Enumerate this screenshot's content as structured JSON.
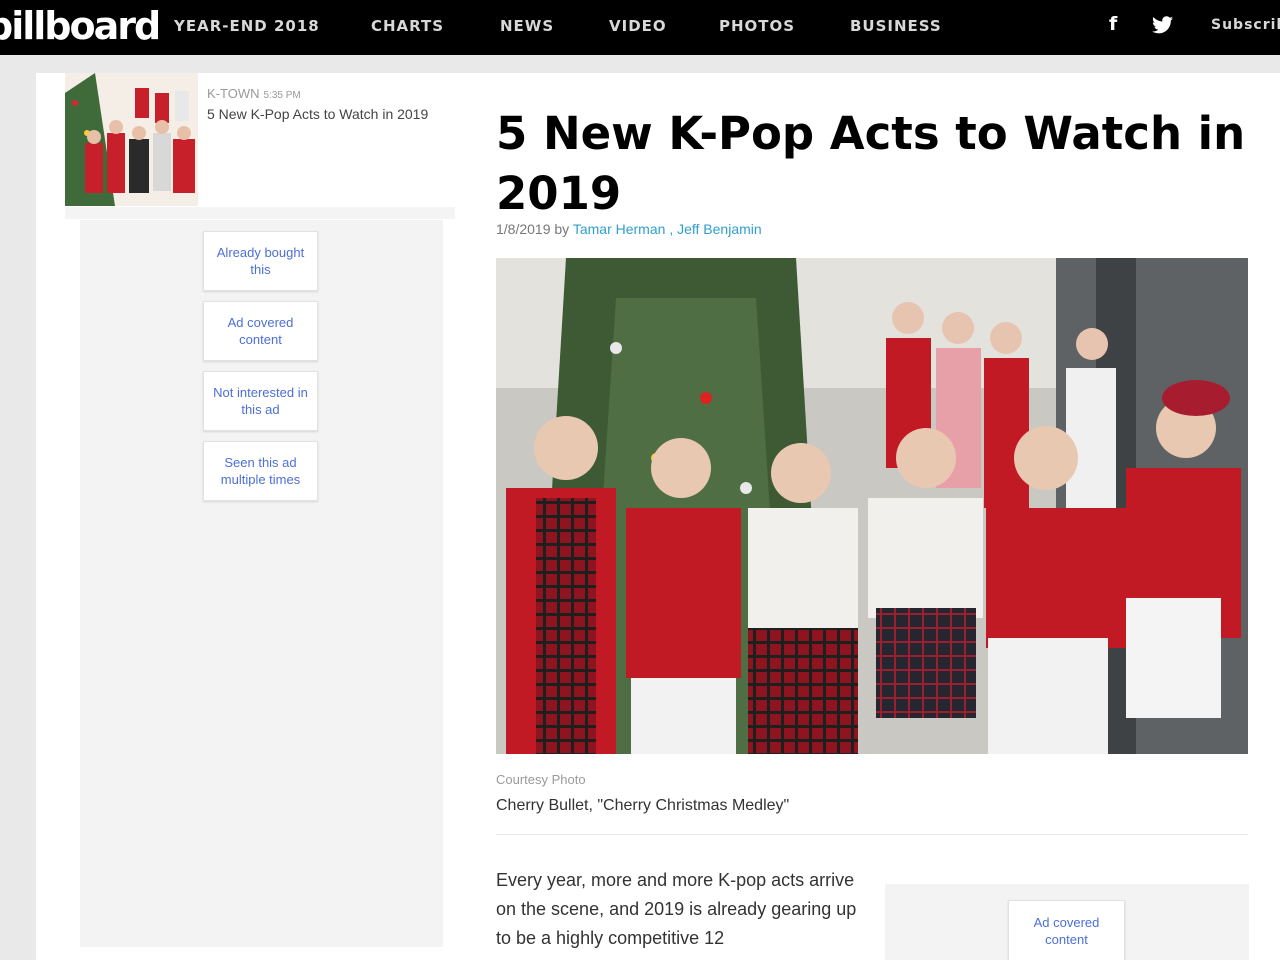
{
  "header": {
    "logo": "billboard",
    "nav": [
      "YEAR-END 2018",
      "CHARTS",
      "NEWS",
      "VIDEO",
      "PHOTOS",
      "BUSINESS"
    ],
    "social": {
      "facebook": "f"
    },
    "subscribe": "Subscribe"
  },
  "sidebar": {
    "story": {
      "kicker": "K-TOWN",
      "time": "5:35 PM",
      "title": "5 New K-Pop Acts to Watch in 2019"
    },
    "ad_feedback": [
      "Already bought this",
      "Ad covered content",
      "Not interested in this ad",
      "Seen this ad multiple times"
    ]
  },
  "article": {
    "headline": "5 New K-Pop Acts to Watch in 2019",
    "date": "1/8/2019",
    "by": "by",
    "authors": [
      "Tamar Herman",
      "Jeff Benjamin"
    ],
    "author_separator": ",",
    "photo_credit": "Courtesy Photo",
    "caption": "Cherry Bullet, \"Cherry Christmas Medley\"",
    "body": "Every year, more and more K-pop acts arrive on the scene, and 2019 is already gearing up to be a highly competitive 12"
  },
  "inline_ad": {
    "button": "Ad covered content"
  },
  "colors": {
    "nav_bg": "#000000",
    "link": "#2f9fd0",
    "ad_text": "#4d6fd6"
  }
}
